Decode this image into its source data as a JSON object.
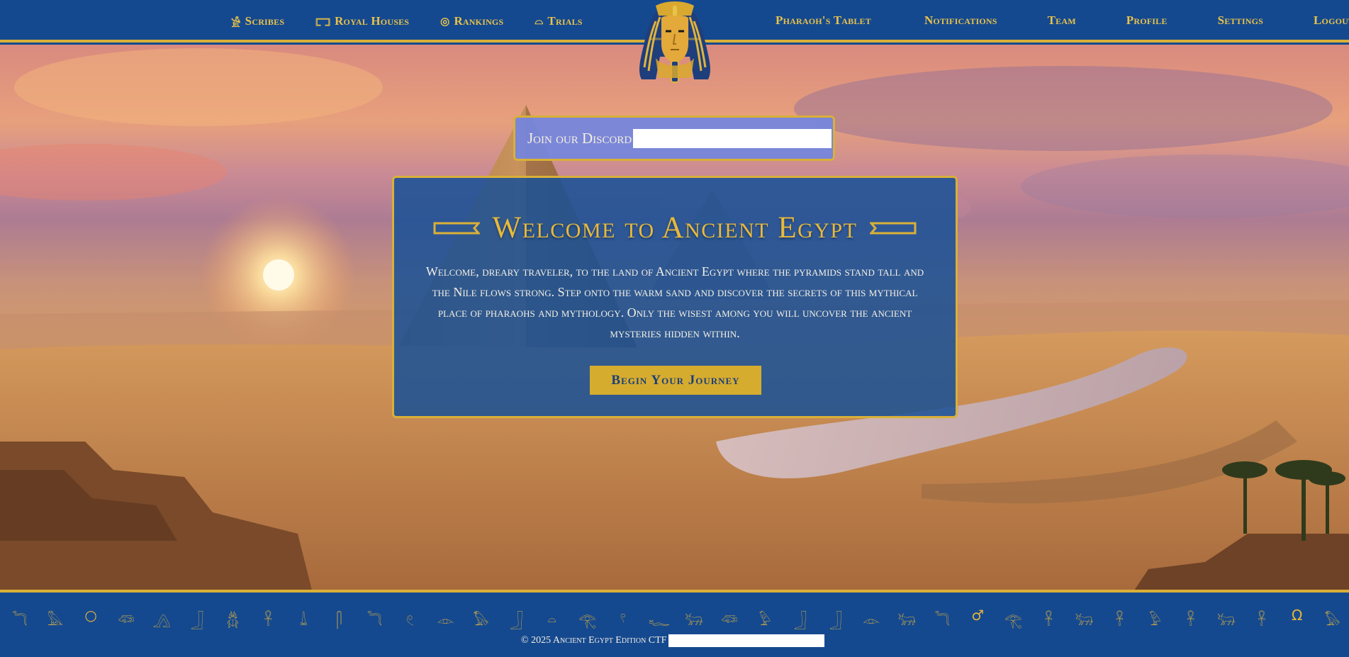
{
  "nav_left": [
    {
      "label": "Scribes",
      "icon": "scribe-icon",
      "glyph": "𓀀"
    },
    {
      "label": "Royal Houses",
      "icon": "obelisk-icon",
      "glyph": "𓉐"
    },
    {
      "label": "Rankings",
      "icon": "sun-disk-icon",
      "glyph": "◎"
    },
    {
      "label": "Trials",
      "icon": "bowl-icon",
      "glyph": "⌓"
    }
  ],
  "nav_right": [
    {
      "label": "Pharaoh's Tablet"
    },
    {
      "label": "Notifications"
    },
    {
      "label": "Team"
    },
    {
      "label": "Profile"
    },
    {
      "label": "Settings"
    },
    {
      "label": "Logout"
    }
  ],
  "discord": {
    "label": "Join our Discord"
  },
  "welcome": {
    "title": "Welcome to Ancient Egypt",
    "text": "Welcome, dreary traveler, to the land of Ancient Egypt where the pyramids stand tall and the Nile flows strong. Step onto the warm sand and discover the secrets of this mythical place of pharaohs and mythology. Only the wisest among you will uncover the ancient mysteries hidden within.",
    "button": "Begin Your Journey"
  },
  "footer": {
    "copyright": "© 2025 Ancient Egypt Edition CTF",
    "glyphs": [
      "𓆓",
      "𓅓",
      "○",
      "𓆛",
      "𓂻",
      "𓃀",
      "𓆣",
      "𓋹",
      "𓍑",
      "𓋴",
      "𓆓",
      "𓏲",
      "𓁹",
      "𓅃",
      "𓃀",
      "𓏏",
      "𓂀",
      "𓍢",
      "𓆑",
      "𓃒",
      "𓆛",
      "𓅱",
      "𓃀",
      "𓃀",
      "𓁹",
      "𓃒",
      "𓆓",
      "♂",
      "𓂀",
      "𓋹",
      "𓃒",
      "𓋹",
      "𓅱",
      "𓋹",
      "𓃒",
      "𓋹",
      "Ω",
      "𓅃"
    ]
  },
  "colors": {
    "header_bg": "#15498f",
    "gold": "#d9b038",
    "panel_bg": "#1a5096",
    "button_bg": "#d6ac2e",
    "discord_bg": "#7686dc"
  }
}
